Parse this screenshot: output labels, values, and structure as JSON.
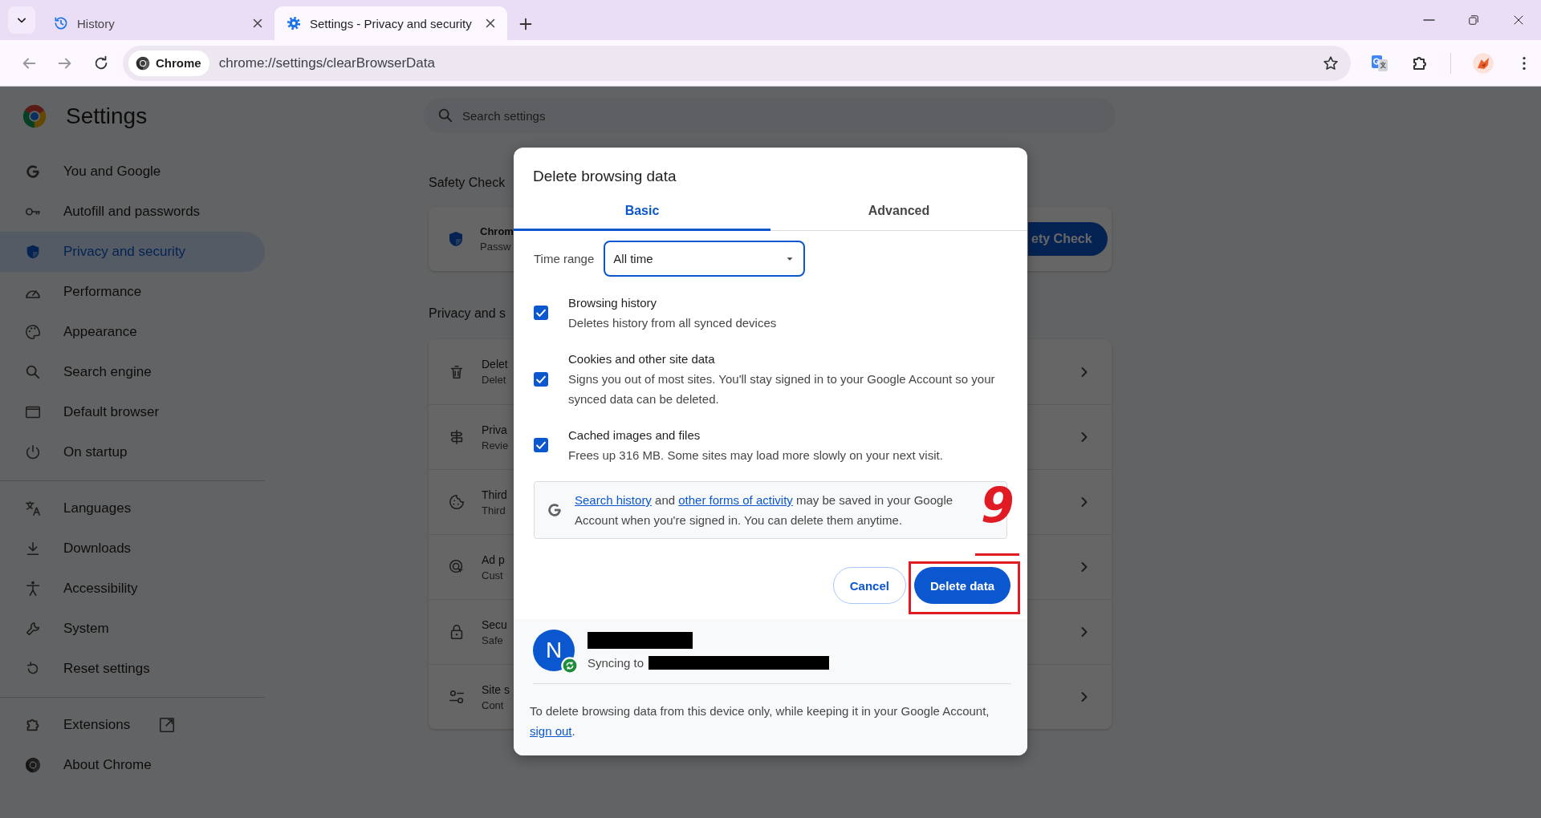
{
  "browser": {
    "tabs": [
      {
        "title": "History",
        "selected": false
      },
      {
        "title": "Settings - Privacy and security",
        "selected": true
      }
    ],
    "address": {
      "chip": "Chrome",
      "url": "chrome://settings/clearBrowserData"
    }
  },
  "sidebar": {
    "title": "Settings",
    "groups": [
      {
        "items": [
          {
            "label": "You and Google",
            "selected": false
          },
          {
            "label": "Autofill and passwords",
            "selected": false
          },
          {
            "label": "Privacy and security",
            "selected": true
          },
          {
            "label": "Performance",
            "selected": false
          },
          {
            "label": "Appearance",
            "selected": false
          },
          {
            "label": "Search engine",
            "selected": false
          },
          {
            "label": "Default browser",
            "selected": false
          },
          {
            "label": "On startup",
            "selected": false
          }
        ]
      },
      {
        "items": [
          {
            "label": "Languages",
            "selected": false
          },
          {
            "label": "Downloads",
            "selected": false
          },
          {
            "label": "Accessibility",
            "selected": false
          },
          {
            "label": "System",
            "selected": false
          },
          {
            "label": "Reset settings",
            "selected": false
          }
        ]
      },
      {
        "items": [
          {
            "label": "Extensions",
            "selected": false
          },
          {
            "label": "About Chrome",
            "selected": false
          }
        ]
      }
    ]
  },
  "main": {
    "search": {
      "placeholder": "Search settings"
    },
    "safety_check": {
      "heading": "Safety Check",
      "title": "Chrom",
      "subtitle": "Passw",
      "button": "ety Check"
    },
    "privacy": {
      "heading": "Privacy and s",
      "rows": [
        {
          "title": "Delet",
          "subtitle": "Delet"
        },
        {
          "title": "Priva",
          "subtitle": "Revie"
        },
        {
          "title": "Third",
          "subtitle": "Third"
        },
        {
          "title": "Ad p",
          "subtitle": "Cust"
        },
        {
          "title": "Secu",
          "subtitle": "Safe"
        },
        {
          "title": "Site s",
          "subtitle": "Cont"
        }
      ]
    }
  },
  "dialog": {
    "title": "Delete browsing data",
    "tabs": [
      {
        "label": "Basic",
        "selected": true
      },
      {
        "label": "Advanced",
        "selected": false
      }
    ],
    "time_range": {
      "label": "Time range",
      "value": "All time"
    },
    "options": [
      {
        "title": "Browsing history",
        "description": "Deletes history from all synced devices",
        "checked": true
      },
      {
        "title": "Cookies and other site data",
        "description": "Signs you out of most sites. You'll stay signed in to your Google Account so your synced data can be deleted.",
        "checked": true
      },
      {
        "title": "Cached images and files",
        "description": "Frees up 316 MB. Some sites may load more slowly on your next visit.",
        "checked": true
      }
    ],
    "notice": [
      {
        "kind": "link",
        "text": "Search history"
      },
      {
        "kind": "text",
        "text": " and "
      },
      {
        "kind": "link",
        "text": "other forms of activity"
      },
      {
        "kind": "text",
        "text": " may be saved in your Google Account when you're signed in. You can delete them anytime."
      }
    ],
    "buttons": [
      {
        "label": "Cancel",
        "kind": "secondary",
        "highlighted": false
      },
      {
        "label": "Delete data",
        "kind": "primary",
        "highlighted": true
      }
    ],
    "account": {
      "initial": "N",
      "sync_label": "Syncing to"
    },
    "note": [
      {
        "kind": "text",
        "text": "To delete browsing data from this device only, while keeping it in your Google Account, "
      },
      {
        "kind": "link",
        "text": "sign out"
      },
      {
        "kind": "text",
        "text": "."
      }
    ]
  },
  "annotation": {
    "step": "9"
  }
}
